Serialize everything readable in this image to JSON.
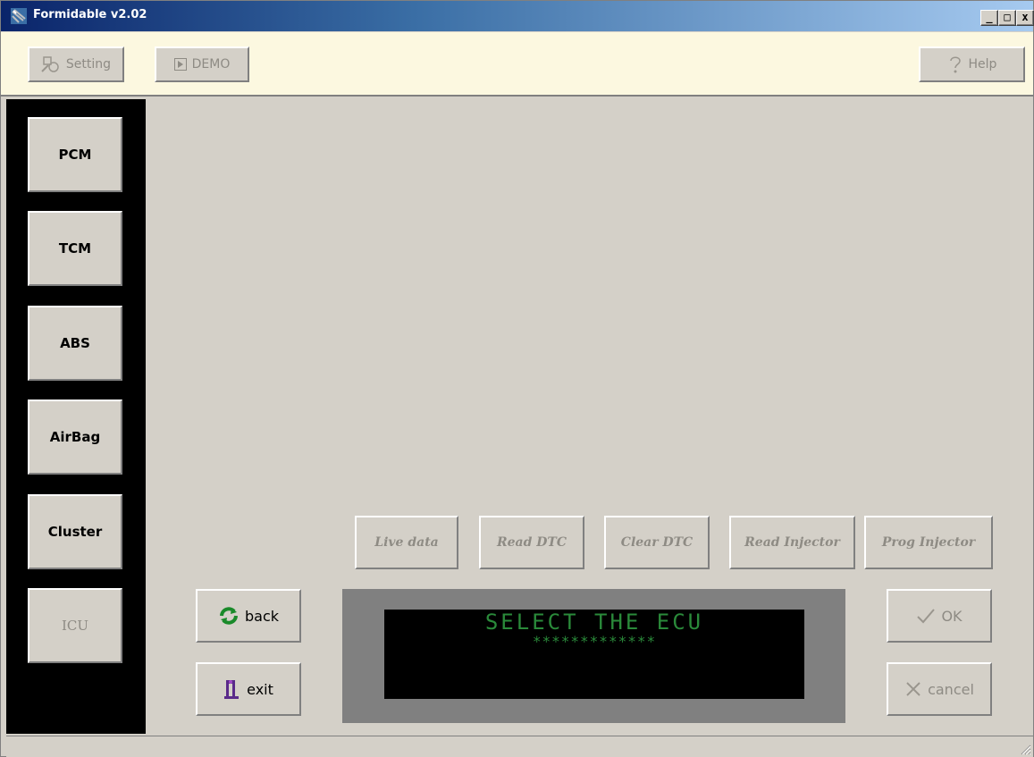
{
  "window": {
    "title": "Formidable v2.02",
    "controls": [
      "_",
      "□",
      "x"
    ]
  },
  "toolbar": {
    "setting_label": "Setting",
    "demo_label": "DEMO",
    "help_label": "Help"
  },
  "sidebar": {
    "items": [
      {
        "label": "PCM"
      },
      {
        "label": "TCM"
      },
      {
        "label": "ABS"
      },
      {
        "label": "AirBag"
      },
      {
        "label": "Cluster"
      },
      {
        "label": "ICU"
      }
    ]
  },
  "functions": {
    "live_data": "Live data",
    "read_dtc": "Read DTC",
    "clear_dtc": "Clear DTC",
    "read_injector": "Read Injector",
    "prog_injector": "Prog Injector"
  },
  "actions": {
    "back": "back",
    "exit": "exit",
    "ok": "OK",
    "cancel": "cancel"
  },
  "display": {
    "line1": "SELECT THE ECU",
    "line2": "*************"
  },
  "colors": {
    "toolbar_bg": "#fcf8e0",
    "panel_bg": "#d4d0c8",
    "display_text": "#2a8a3a",
    "disabled_text": "#8e8b84"
  }
}
